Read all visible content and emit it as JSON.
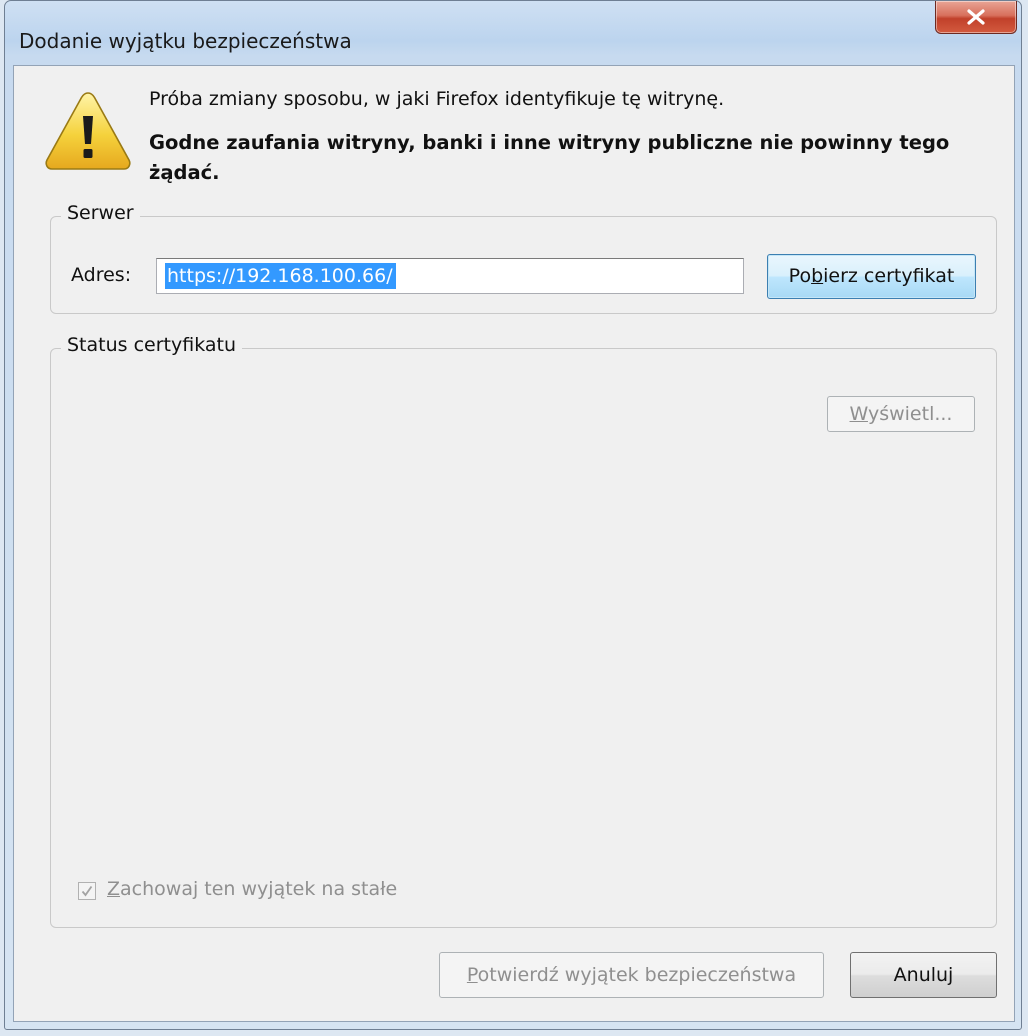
{
  "window": {
    "title": "Dodanie wyjątku bezpieczeństwa"
  },
  "icons": {
    "warning": "warning-triangle-icon",
    "close": "close-x-icon",
    "checkmark": "checkmark-icon"
  },
  "message": {
    "line1": "Próba zmiany sposobu, w jaki Firefox identyfikuje tę witrynę.",
    "line2": "Godne zaufania witryny, banki i inne witryny publiczne nie powinny tego żądać."
  },
  "server": {
    "legend": "Serwer",
    "address_label": "Adres:",
    "address_value": "https://192.168.100.66/",
    "fetch_button": {
      "before": "Po",
      "accel": "b",
      "after": "ierz certyfikat"
    }
  },
  "status": {
    "legend": "Status certyfikatu",
    "view_button": {
      "before": "",
      "accel": "W",
      "after": "yświetl..."
    },
    "permanent_checkbox": {
      "checked": true,
      "enabled": false,
      "label_before": "",
      "label_accel": "Z",
      "label_after": "achowaj ten wyjątek na stałe"
    }
  },
  "footer": {
    "confirm_button": {
      "before": "",
      "accel": "P",
      "after": "otwierdź wyjątek bezpieczeństwa"
    },
    "cancel_button": "Anuluj"
  },
  "colors": {
    "selection": "#3399ff",
    "close_button": "#c1402a",
    "warning_yellow": "#f5d23c",
    "disabled_text": "#8f8f8f"
  }
}
